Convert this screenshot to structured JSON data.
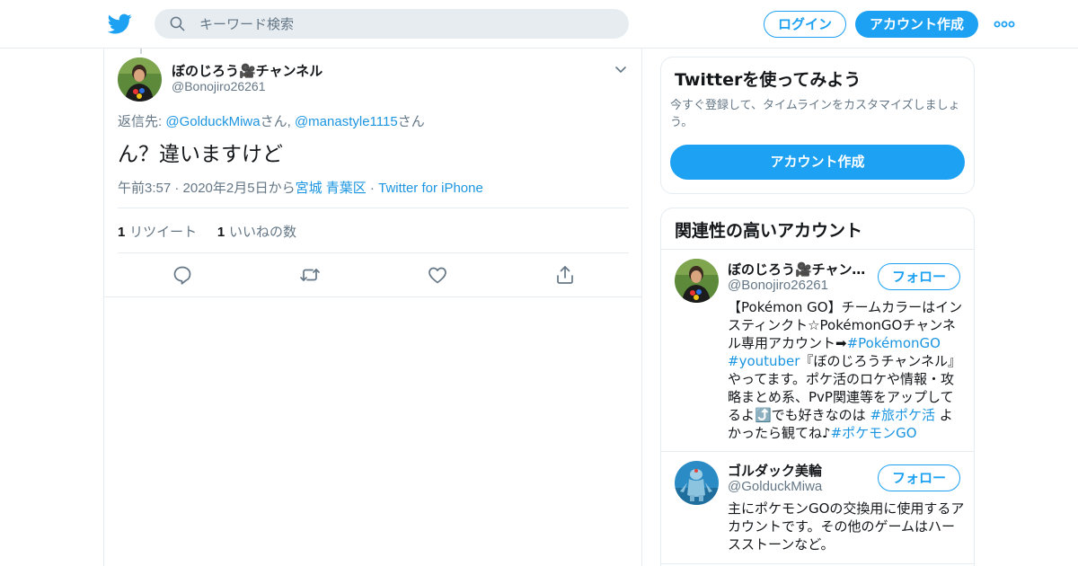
{
  "header": {
    "search_placeholder": "キーワード検索",
    "login_label": "ログイン",
    "signup_label": "アカウント作成",
    "brand_color": "#1da1f2",
    "icons": [
      "twitter-bird-icon",
      "search-icon",
      "more-dots-icon"
    ]
  },
  "tweet": {
    "display_name": "ぼのじろう🎥チャンネル",
    "handle": "@Bonojiro26261",
    "reply_prefix": "返信先: ",
    "reply_user1": "@GolduckMiwa",
    "reply_sep": "さん, ",
    "reply_user2": "@manastyle1115",
    "reply_suffix": "さん",
    "text": "ん？違いますけど",
    "time": "午前3:57 · 2020年2月5日から",
    "location": "宮城 青葉区",
    "dot": " · ",
    "source": "Twitter for iPhone",
    "retweet_count": "1",
    "retweet_label": " リツイート",
    "like_count": "1",
    "like_label": " いいねの数",
    "actions": [
      "reply-icon",
      "retweet-icon",
      "like-icon",
      "share-icon"
    ]
  },
  "signup_card": {
    "title": "Twitterを使ってみよう",
    "description": "今すぐ登録して、タイムラインをカスタマイズしましょう。",
    "button_label": "アカウント作成"
  },
  "related": {
    "title": "関連性の高いアカウント",
    "follow_label": "フォロー",
    "accounts": [
      {
        "name": "ぼのじろう🎥チャンネル",
        "handle": "@Bonojiro26261",
        "bio_1": "【Pokémon GO】チームカラーはインスティンクト☆PokémonGOチャンネル専用アカウント➡",
        "tag_1": "#PokémonGO",
        "tag_2": "#youtuber",
        "bio_2": "『ぼのじろうチャンネル』やってます。ポケ活のロケや情報・攻略まとめ系、PvP関連等をアップしてるよ⤴️でも好きなのは ",
        "tag_3": "#旅ポケ活",
        "bio_3": " よかったら観てね♪",
        "tag_4": "#ポケモンGO"
      },
      {
        "name": "ゴルダック美輪",
        "handle": "@GolduckMiwa",
        "bio": "主にポケモンGOの交換用に使用するアカウントです。その他のゲームはハースストーンなど。"
      }
    ]
  }
}
